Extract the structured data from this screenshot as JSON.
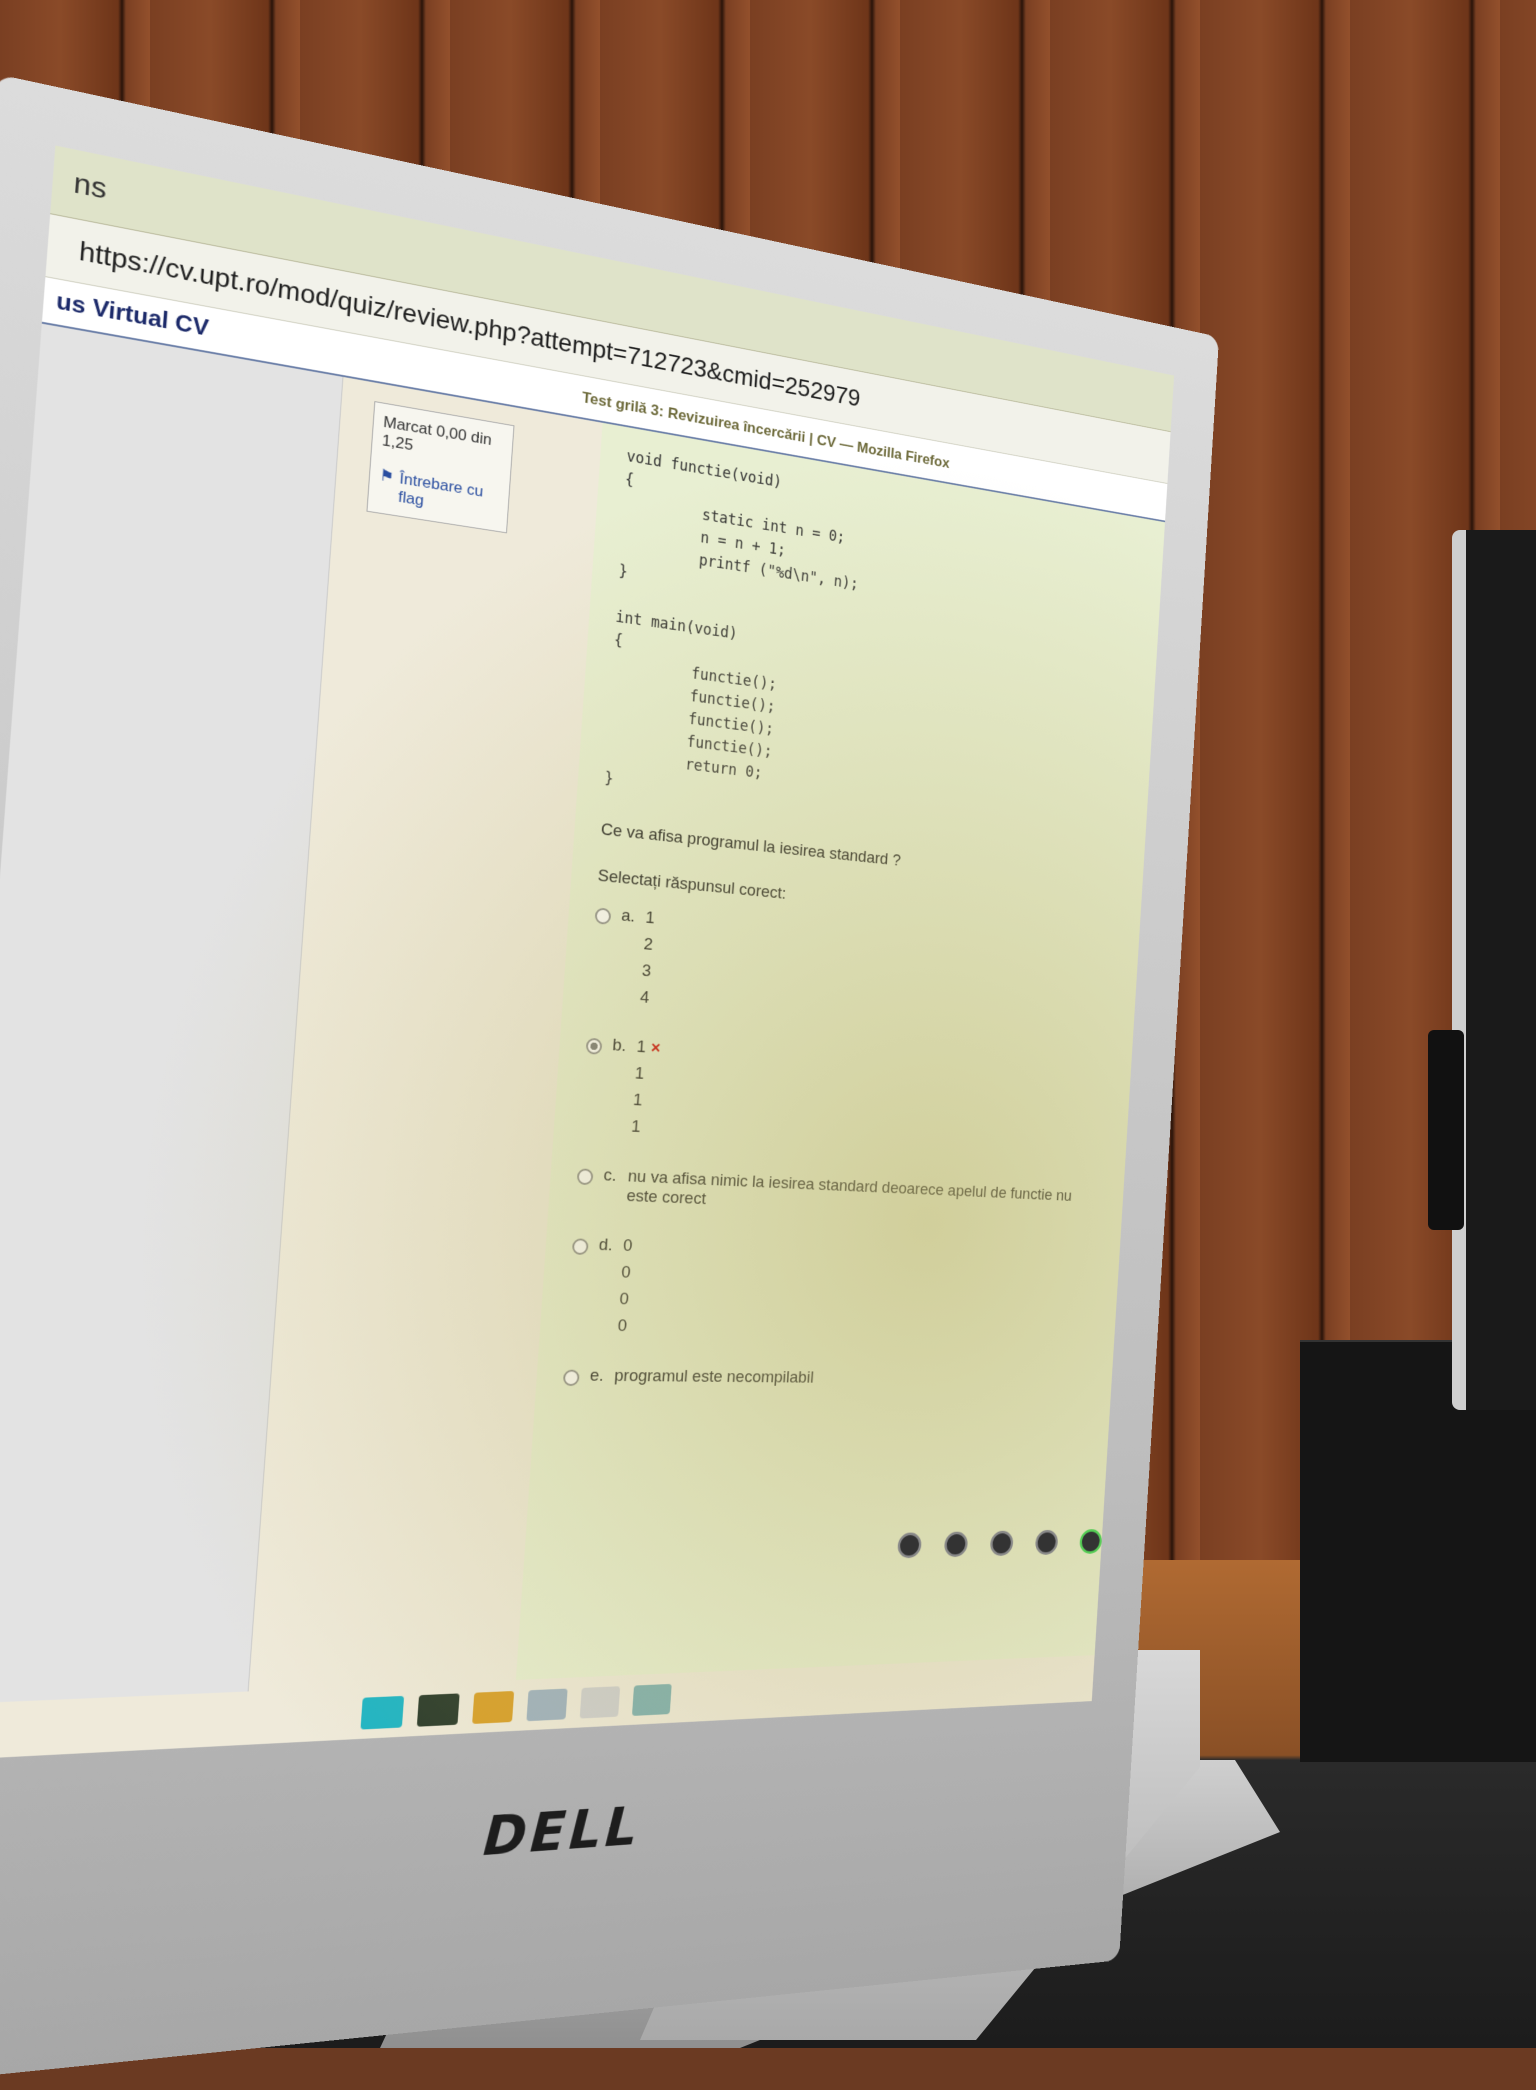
{
  "browser": {
    "tab_title": "ns",
    "window_title": "Test grilă 3: Revizuirea încercării | CV — Mozilla Firefox",
    "url": "https://cv.upt.ro/mod/quiz/review.php?attempt=712723&cmid=252979"
  },
  "site": {
    "logo_text": "us Virtual CV"
  },
  "question_info": {
    "mark_text": "Marcat 0,00 din 1,25",
    "flag_label": "Întrebare cu flag"
  },
  "question": {
    "code_lines": [
      "void functie(void)",
      "{",
      "         static int n = 0;",
      "         n = n + 1;",
      "         printf (\"%d\\n\", n);",
      "}",
      "",
      "int main(void)",
      "{",
      "         functie();",
      "         functie();",
      "         functie();",
      "         functie();",
      "         return 0;",
      "}"
    ],
    "prompt": "Ce va afisa programul la iesirea standard ?",
    "instruction": "Selectați răspunsul corect:",
    "options": [
      {
        "letter": "a.",
        "lines": [
          "1",
          "2",
          "3",
          "4"
        ],
        "selected": false,
        "wrong": false
      },
      {
        "letter": "b.",
        "lines": [
          "1",
          "1",
          "1",
          "1"
        ],
        "selected": true,
        "wrong": true
      },
      {
        "letter": "c.",
        "lines": [
          "nu va afisa nimic la iesirea standard deoarece apelul de functie nu este corect"
        ],
        "selected": false,
        "wrong": false
      },
      {
        "letter": "d.",
        "lines": [
          "0",
          "0",
          "0",
          "0"
        ],
        "selected": false,
        "wrong": false
      },
      {
        "letter": "e.",
        "lines": [
          "programul este necompilabil"
        ],
        "selected": false,
        "wrong": false
      }
    ],
    "wrong_mark": "×"
  },
  "monitor": {
    "brand": "DELL"
  },
  "colors": {
    "accent": "#2a4ea0",
    "wrong": "#cc0000",
    "screen_bg": "#e8efd2"
  }
}
